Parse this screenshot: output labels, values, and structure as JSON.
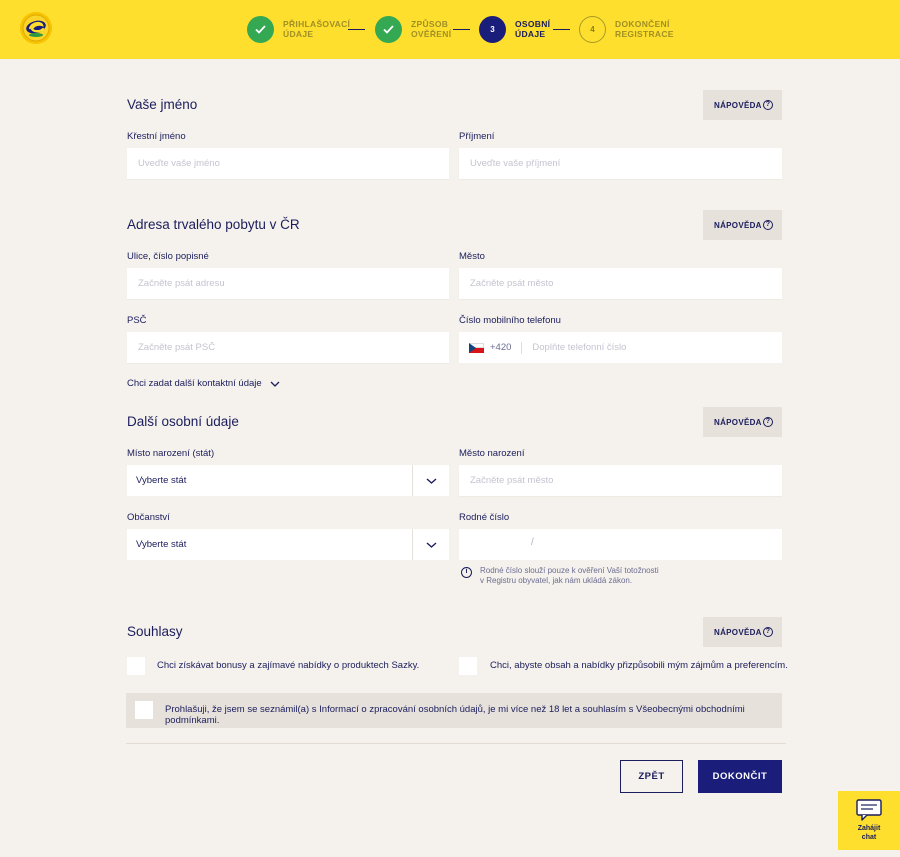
{
  "steps": [
    {
      "number": "",
      "label": "PŘIHLAŠOVACÍ\nÚDAJE",
      "state": "done"
    },
    {
      "number": "",
      "label": "ZPŮSOB\nOVĚŘENÍ",
      "state": "done"
    },
    {
      "number": "3",
      "label": "OSOBNÍ\nÚDAJE",
      "state": "active"
    },
    {
      "number": "4",
      "label": "DOKONČENÍ\nREGISTRACE",
      "state": "todo"
    }
  ],
  "help_label": "NÁPOVĚDA",
  "name_section": {
    "title": "Vaše jméno",
    "first_name_label": "Křestní jméno",
    "first_name_placeholder": "Uveďte vaše jméno",
    "last_name_label": "Příjmení",
    "last_name_placeholder": "Uveďte vaše příjmení"
  },
  "address_section": {
    "title": "Adresa trvalého pobytu v ČR",
    "street_label": "Ulice, číslo popisné",
    "street_placeholder": "Začněte psát adresu",
    "city_label": "Město",
    "city_placeholder": "Začněte psát město",
    "zip_label": "PSČ",
    "zip_placeholder": "Začněte psát PSČ",
    "phone_label": "Číslo mobilního telefonu",
    "phone_prefix": "+420",
    "phone_placeholder": "Doplňte telefonní číslo",
    "more_contact": "Chci zadat další kontaktní údaje"
  },
  "personal_section": {
    "title": "Další osobní údaje",
    "birth_country_label": "Místo narození (stát)",
    "birth_country_value": "Vyberte stát",
    "birth_city_label": "Město narození",
    "birth_city_placeholder": "Začněte psát město",
    "citizenship_label": "Občanství",
    "citizenship_value": "Vyberte stát",
    "birth_number_label": "Rodné číslo",
    "birth_number_separator": "/",
    "birth_number_info": "Rodné číslo slouží pouze k ověření Vaší totožnosti\nv Registru obyvatel, jak nám ukládá zákon."
  },
  "consents_section": {
    "title": "Souhlasy",
    "bonus_consent": "Chci získávat bonusy a zajímavé nabídky o produktech Sazky.",
    "personalize_consent": "Chci, abyste obsah a nabídky přizpůsobili mým zájmům a preferencím.",
    "terms_consent": "Prohlašuji, že jsem se seznámil(a) s Informací o zpracování osobních údajů, je mi více než 18 let a souhlasím s Všeobecnými obchodními podmínkami."
  },
  "buttons": {
    "back": "ZPĚT",
    "finish": "DOKONČIT"
  },
  "chat": {
    "label": "Zahájit\nchat",
    "icon": "chat-bubble-icon"
  },
  "colors": {
    "brand_yellow": "#fedf2d",
    "brand_navy": "#1b1d7a",
    "success_green": "#35a853",
    "background": "#f5f1ec"
  }
}
